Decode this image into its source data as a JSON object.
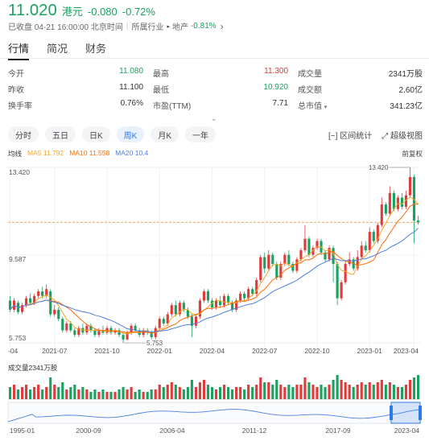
{
  "quote": {
    "price": "11.020",
    "currency": "港元",
    "change": "-0.080",
    "change_pct": "-0.72%"
  },
  "status": {
    "market_state": "已收盘 04-21 16:00:00 北京时间",
    "industry_label": "所属行业",
    "industry_name": "地产",
    "industry_change": "-0.81%"
  },
  "tabs": [
    "行情",
    "简况",
    "财务"
  ],
  "stats": [
    [
      {
        "label": "今开",
        "value": "11.080",
        "color": "green"
      },
      {
        "label": "最高",
        "value": "11.300",
        "color": "red"
      },
      {
        "label": "成交量",
        "value": "2341万股",
        "color": "normal"
      }
    ],
    [
      {
        "label": "昨收",
        "value": "11.100",
        "color": "normal"
      },
      {
        "label": "最低",
        "value": "10.920",
        "color": "green"
      },
      {
        "label": "成交额",
        "value": "2.60亿",
        "color": "normal"
      }
    ],
    [
      {
        "label": "换手率",
        "value": "0.76%",
        "color": "normal"
      },
      {
        "label": "市盈(TTM)",
        "value": "7.71",
        "color": "normal"
      },
      {
        "label": "总市值",
        "value": "341.23亿",
        "color": "normal"
      }
    ]
  ],
  "periods": [
    "分时",
    "五日",
    "日K",
    "周K",
    "月K",
    "一年"
  ],
  "active_period": "周K",
  "tools": {
    "interval_stats": "区间统计",
    "super_view": "超级视图"
  },
  "ma": {
    "label": "均线",
    "ma5": "MA5 11.792",
    "ma10": "MA10 11.558",
    "ma20": "MA20 10.4",
    "adjust": "前复权"
  },
  "colors": {
    "up": "#e03a3a",
    "down": "#19a15f",
    "ma5": "#f5a623",
    "ma10": "#ff6a00",
    "ma20": "#4a7fe0",
    "accent": "#2f7be6"
  },
  "chart_data": {
    "type": "candlestick",
    "y_ticks": [
      "13.420",
      "9.587",
      "5.753"
    ],
    "ylim": [
      5.753,
      13.42
    ],
    "high_mark": "13.420",
    "low_mark": "5.753",
    "last_close": 11.02,
    "x_ticks": [
      "-04",
      "2021-07",
      "2021-10",
      "2022-01",
      "2022-04",
      "2022-07",
      "2022-10",
      "2023-01",
      "2023-04"
    ],
    "volume_label": "成交量2341万股",
    "overview_ticks": [
      "1995-01",
      "2000-09",
      "2006-04",
      "2011-12",
      "2017-09",
      "2023-04"
    ],
    "candles": [
      [
        7.6,
        7.2,
        7.8,
        7.1
      ],
      [
        7.2,
        7.6,
        7.7,
        7.1
      ],
      [
        7.5,
        7.1,
        7.6,
        7.0
      ],
      [
        7.1,
        7.4,
        7.5,
        7.0
      ],
      [
        7.4,
        7.7,
        7.8,
        7.3
      ],
      [
        7.7,
        7.5,
        7.9,
        7.4
      ],
      [
        7.5,
        7.8,
        7.9,
        7.4
      ],
      [
        7.8,
        8.0,
        8.1,
        7.7
      ],
      [
        8.0,
        7.8,
        8.2,
        7.7
      ],
      [
        7.8,
        8.1,
        8.3,
        7.7
      ],
      [
        8.0,
        7.0,
        8.1,
        6.9
      ],
      [
        7.0,
        7.2,
        7.4,
        6.9
      ],
      [
        7.2,
        6.8,
        7.3,
        6.7
      ],
      [
        6.8,
        6.3,
        6.9,
        6.2
      ],
      [
        6.3,
        6.6,
        6.7,
        6.2
      ],
      [
        6.6,
        6.3,
        6.7,
        6.2
      ],
      [
        6.3,
        6.1,
        6.4,
        6.0
      ],
      [
        6.1,
        6.4,
        6.5,
        6.0
      ],
      [
        6.4,
        6.2,
        6.6,
        6.1
      ],
      [
        6.2,
        6.5,
        6.6,
        6.1
      ],
      [
        6.5,
        6.3,
        6.6,
        6.2
      ],
      [
        6.3,
        6.1,
        6.4,
        6.0
      ],
      [
        6.1,
        6.3,
        6.4,
        6.0
      ],
      [
        6.3,
        6.2,
        6.5,
        6.1
      ],
      [
        6.2,
        6.4,
        6.5,
        6.1
      ],
      [
        6.4,
        6.2,
        6.5,
        6.1
      ],
      [
        6.2,
        6.3,
        6.4,
        6.1
      ],
      [
        6.3,
        6.1,
        6.4,
        6.0
      ],
      [
        6.1,
        5.9,
        6.2,
        5.75
      ],
      [
        5.9,
        6.2,
        6.3,
        5.85
      ],
      [
        6.2,
        6.5,
        6.6,
        6.1
      ],
      [
        6.5,
        6.3,
        6.6,
        6.2
      ],
      [
        6.3,
        6.1,
        6.4,
        6.0
      ],
      [
        6.1,
        6.3,
        6.4,
        6.0
      ],
      [
        6.3,
        6.2,
        6.4,
        6.1
      ],
      [
        6.2,
        6.0,
        6.3,
        5.9
      ],
      [
        6.0,
        6.4,
        6.5,
        5.9
      ],
      [
        6.4,
        6.8,
        6.9,
        6.3
      ],
      [
        6.8,
        6.6,
        6.9,
        6.5
      ],
      [
        6.6,
        7.0,
        7.1,
        6.5
      ],
      [
        7.0,
        7.4,
        7.5,
        6.9
      ],
      [
        7.4,
        7.0,
        7.6,
        6.9
      ],
      [
        7.0,
        7.5,
        7.6,
        6.9
      ],
      [
        7.5,
        7.2,
        7.6,
        7.1
      ],
      [
        7.2,
        6.9,
        7.3,
        6.8
      ],
      [
        6.9,
        6.5,
        7.0,
        6.0
      ],
      [
        6.5,
        6.9,
        7.0,
        6.4
      ],
      [
        6.9,
        7.6,
        7.7,
        6.8
      ],
      [
        7.6,
        8.0,
        8.1,
        7.5
      ],
      [
        8.0,
        7.6,
        8.1,
        7.5
      ],
      [
        7.6,
        7.3,
        7.7,
        7.2
      ],
      [
        7.3,
        7.6,
        7.7,
        7.2
      ],
      [
        7.6,
        7.4,
        7.8,
        7.3
      ],
      [
        7.4,
        7.8,
        7.9,
        7.3
      ],
      [
        7.8,
        7.5,
        7.9,
        7.4
      ],
      [
        7.5,
        7.2,
        7.6,
        7.1
      ],
      [
        7.2,
        7.6,
        7.7,
        7.1
      ],
      [
        7.6,
        7.9,
        8.0,
        7.5
      ],
      [
        7.9,
        7.7,
        8.0,
        7.6
      ],
      [
        7.7,
        8.1,
        8.2,
        7.6
      ],
      [
        8.1,
        7.9,
        8.2,
        7.8
      ],
      [
        7.9,
        8.5,
        8.6,
        7.8
      ],
      [
        8.5,
        9.5,
        9.6,
        8.4
      ],
      [
        9.5,
        9.0,
        9.7,
        8.8
      ],
      [
        9.0,
        9.6,
        9.8,
        8.9
      ],
      [
        9.6,
        9.2,
        9.7,
        9.1
      ],
      [
        9.2,
        8.6,
        9.3,
        8.5
      ],
      [
        8.6,
        9.2,
        9.3,
        8.5
      ],
      [
        9.2,
        9.6,
        9.7,
        9.1
      ],
      [
        9.6,
        9.2,
        9.8,
        9.1
      ],
      [
        9.2,
        8.9,
        9.3,
        8.8
      ],
      [
        8.9,
        9.4,
        9.5,
        8.8
      ],
      [
        9.4,
        9.8,
        9.9,
        9.3
      ],
      [
        9.8,
        10.3,
        10.9,
        9.7
      ],
      [
        10.3,
        9.6,
        10.4,
        9.5
      ],
      [
        9.6,
        9.9,
        10.0,
        9.5
      ],
      [
        9.9,
        10.2,
        10.3,
        9.8
      ],
      [
        10.2,
        9.7,
        10.3,
        9.6
      ],
      [
        9.7,
        9.4,
        9.8,
        9.3
      ],
      [
        9.4,
        9.9,
        10.0,
        9.3
      ],
      [
        9.9,
        9.2,
        10.0,
        8.4
      ],
      [
        9.2,
        7.7,
        9.3,
        7.4
      ],
      [
        7.7,
        8.4,
        8.5,
        7.6
      ],
      [
        8.4,
        9.2,
        9.3,
        8.3
      ],
      [
        9.2,
        9.4,
        9.7,
        9.1
      ],
      [
        9.4,
        9.0,
        9.5,
        8.9
      ],
      [
        9.0,
        9.5,
        9.8,
        8.9
      ],
      [
        9.5,
        10.0,
        10.2,
        9.4
      ],
      [
        10.0,
        9.8,
        10.2,
        9.7
      ],
      [
        9.8,
        10.6,
        10.8,
        9.7
      ],
      [
        10.6,
        10.2,
        10.7,
        10.1
      ],
      [
        10.2,
        10.9,
        11.0,
        10.1
      ],
      [
        10.9,
        11.8,
        12.1,
        10.8
      ],
      [
        11.8,
        11.4,
        11.9,
        11.3
      ],
      [
        11.4,
        12.3,
        12.6,
        11.3
      ],
      [
        12.3,
        11.6,
        12.4,
        11.5
      ],
      [
        11.6,
        12.1,
        12.2,
        11.5
      ],
      [
        12.1,
        11.7,
        12.3,
        11.6
      ],
      [
        11.7,
        12.2,
        12.4,
        11.6
      ],
      [
        12.2,
        13.0,
        13.42,
        12.1
      ],
      [
        13.0,
        11.1,
        13.1,
        10.1
      ],
      [
        11.1,
        11.02,
        11.3,
        10.92
      ]
    ],
    "volumes": [
      5,
      6,
      4,
      5,
      6,
      4,
      5,
      6,
      4,
      5,
      9,
      6,
      5,
      7,
      4,
      5,
      6,
      4,
      5,
      4,
      3,
      4,
      3,
      4,
      3,
      3,
      3,
      4,
      5,
      4,
      5,
      3,
      4,
      3,
      3,
      4,
      4,
      6,
      5,
      6,
      7,
      6,
      5,
      4,
      5,
      8,
      5,
      7,
      8,
      6,
      5,
      4,
      5,
      6,
      5,
      4,
      5,
      5,
      4,
      6,
      5,
      6,
      9,
      7,
      7,
      6,
      8,
      6,
      5,
      6,
      5,
      6,
      6,
      9,
      7,
      6,
      5,
      6,
      5,
      6,
      8,
      10,
      8,
      7,
      6,
      5,
      6,
      7,
      6,
      7,
      6,
      7,
      8,
      6,
      7,
      6,
      5,
      5,
      6,
      8,
      9,
      10
    ]
  }
}
